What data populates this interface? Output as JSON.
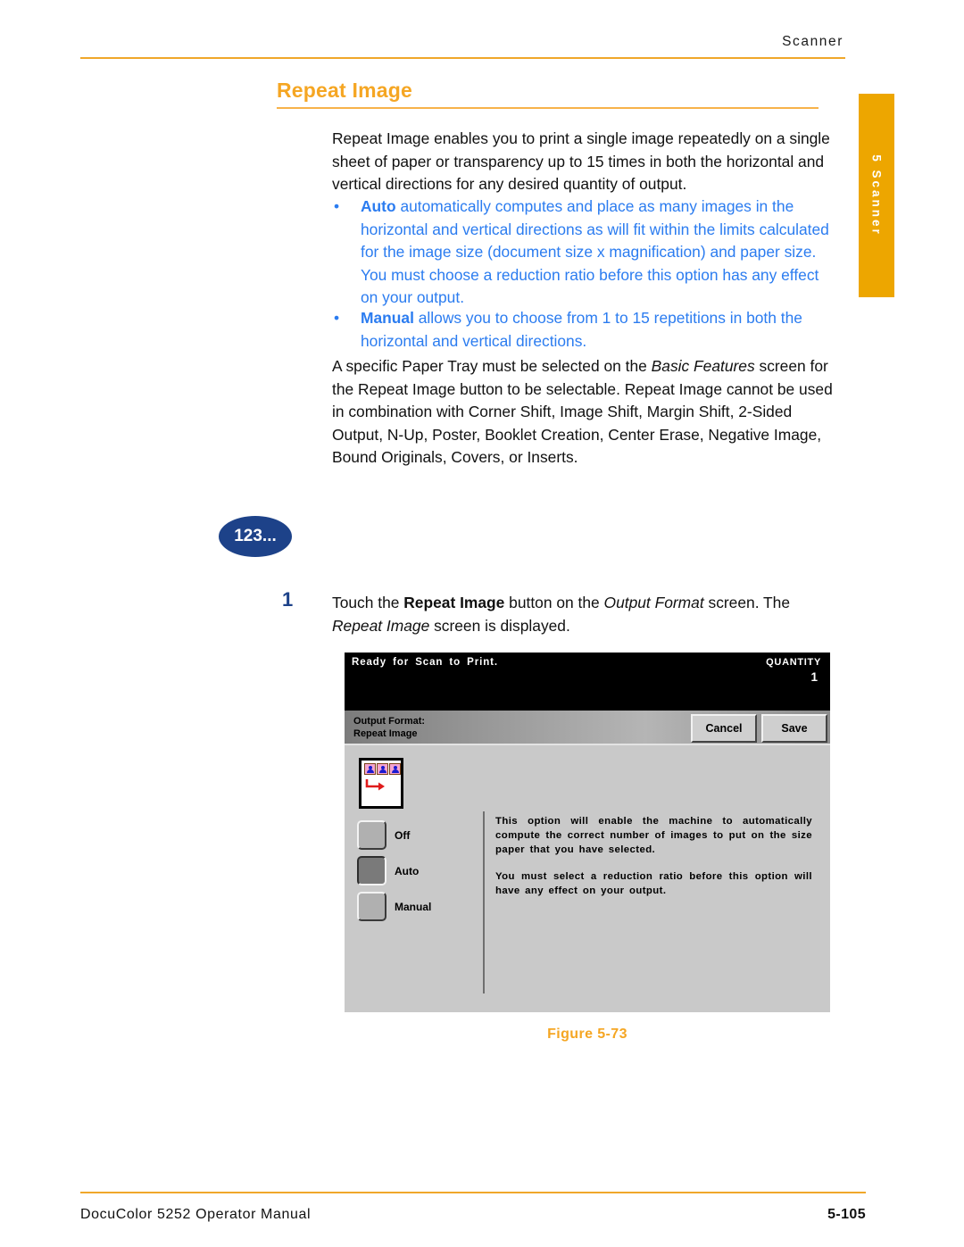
{
  "page": {
    "running_header": "Scanner",
    "side_tab": "5 Scanner",
    "accent_orange": "#F5A623",
    "accent_blue": "#2B7CF0",
    "badge_navy": "#1D4289"
  },
  "section": {
    "title": "Repeat Image",
    "intro": "Repeat Image enables you to print a single image repeatedly on a single sheet of paper or transparency up to 15 times in both the horizontal and vertical directions for any desired quantity of output.",
    "bullets": [
      {
        "term": "Auto",
        "text": " automatically computes and place as many images in the horizontal and vertical directions as will fit within the limits calculated for the image size (document size x magnification) and paper size. You must choose a reduction ratio before this option has any effect on your output.",
        "marker": "•"
      },
      {
        "term": "Manual",
        "text": " allows you to choose from 1 to 15 repetitions in both the horizontal and vertical directions.",
        "marker": "•"
      }
    ],
    "note_parts": {
      "a": "A specific Paper Tray must be selected on the ",
      "b_italic": "Basic Features",
      "c": " screen for the Repeat Image button to be selectable. Repeat Image cannot be used in combination with Corner Shift, Image Shift, Margin Shift, 2-Sided Output, N-Up, Poster, Booklet Creation, Center Erase, Negative Image, Bound Originals, Covers, or Inserts."
    }
  },
  "procedure": {
    "badge": "123...",
    "step_number": "1",
    "step_parts": {
      "a": "Touch the ",
      "b_bold": "Repeat Image",
      "c": " button on the ",
      "d_italic": "Output Format",
      "e": " screen. The ",
      "f_italic": "Repeat Image",
      "g": " screen is displayed."
    }
  },
  "lcd": {
    "status_message": "Ready for Scan to Print.",
    "quantity_label": "QUANTITY",
    "quantity_value": "1",
    "title_line1": "Output Format:",
    "title_line2": "Repeat Image",
    "cancel_label": "Cancel",
    "save_label": "Save",
    "preview_icon": "repeat-image-preview-icon",
    "options": [
      {
        "label": "Off",
        "selected": false
      },
      {
        "label": "Auto",
        "selected": true
      },
      {
        "label": "Manual",
        "selected": false
      }
    ],
    "description": [
      "This option will enable the machine to automatically compute the correct number of images to put on the size paper that you have selected.",
      "You must select a reduction ratio before this option will have any effect on your output."
    ]
  },
  "figure": {
    "caption": "Figure 5-73"
  },
  "footer": {
    "left": "DocuColor 5252 Operator Manual",
    "right": "5-105"
  }
}
